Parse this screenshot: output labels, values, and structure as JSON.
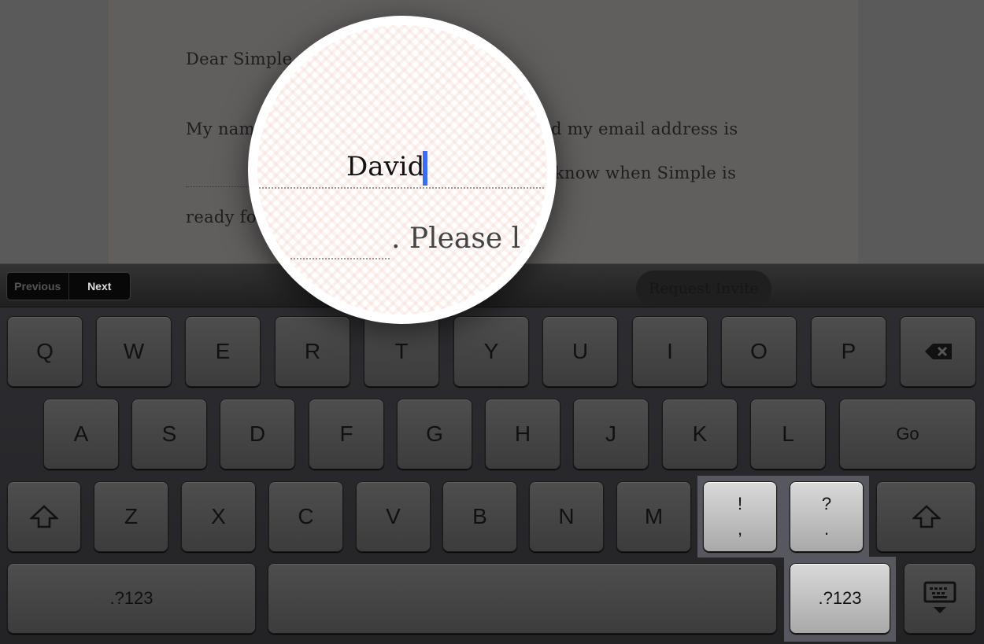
{
  "letter": {
    "line1": "Dear Simple",
    "line2": "My nam",
    "line2b": "d my email address is",
    "line3": "know when Simple is",
    "line4": "ready fo"
  },
  "magnifier": {
    "name_value": "David",
    "next_text": ". Please l",
    "cursor_color": "#3d6cf0"
  },
  "toolbar": {
    "previous": "Previous",
    "next": "Next",
    "request_invite": "Request Invite"
  },
  "keyboard": {
    "row1": [
      "Q",
      "W",
      "E",
      "R",
      "T",
      "Y",
      "U",
      "I",
      "O",
      "P"
    ],
    "row2": [
      "A",
      "S",
      "D",
      "F",
      "G",
      "H",
      "J",
      "K",
      "L"
    ],
    "go": "Go",
    "row3": [
      "Z",
      "X",
      "C",
      "V",
      "B",
      "N",
      "M"
    ],
    "punct1": {
      "top": "!",
      "bottom": ","
    },
    "punct2": {
      "top": "?",
      "bottom": "."
    },
    "numbers": ".?123",
    "icons": {
      "delete": "backspace-icon",
      "shift": "shift-arrow-icon",
      "hide": "keyboard-hide-icon"
    }
  }
}
